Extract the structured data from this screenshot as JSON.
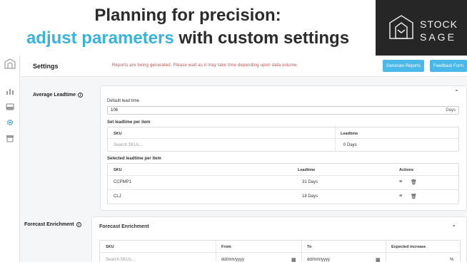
{
  "banner": {
    "headline_line1": "Planning for precision:",
    "headline_accent": "adjust parameters",
    "headline_rest": " with custom settings",
    "logo_word1": "STOCK",
    "logo_word2": "SAGE",
    "accent_color": "#3ab3dc"
  },
  "sidebar": {
    "items": [
      {
        "icon": "logo-icon"
      },
      {
        "icon": "bar-chart-icon"
      },
      {
        "icon": "inbox-icon"
      },
      {
        "icon": "gear-icon",
        "active": true
      },
      {
        "icon": "archive-icon"
      }
    ]
  },
  "header": {
    "title": "Settings",
    "status_message": "Reports are being generated. Please wait as it may take time depending upon data volume.",
    "generate_label": "Generate Reports",
    "feedback_label": "Feedback Form"
  },
  "leadtime": {
    "section_label": "Average Leadtime",
    "default_label": "Default lead time",
    "default_value": "106",
    "default_unit": "Days",
    "set_label": "Set leadtime per item",
    "set_table": {
      "col_sku": "SKU",
      "col_leadtime": "Leadtime",
      "sku_placeholder": "Search SKUs...",
      "leadtime_placeholder": "0 Days"
    },
    "selected_label": "Selected leadtime per item",
    "selected_table": {
      "col_sku": "SKU",
      "col_leadtime": "Leadtime",
      "col_actions": "Actions",
      "rows": [
        {
          "sku": "CCPMP1",
          "leadtime": "31 Days"
        },
        {
          "sku": "CLJ",
          "leadtime": "18 Days"
        }
      ]
    }
  },
  "forecast": {
    "section_label": "Forecast Enrichment",
    "card_title": "Forecast Enrichment",
    "col_sku": "SKU",
    "col_from": "From",
    "col_to": "To",
    "col_increase": "Expected increase",
    "sku_placeholder": "Search SKUs...",
    "from_placeholder": "dd/mm/yyyy",
    "to_placeholder": "dd/mm/yyyy",
    "increase_unit": "%"
  }
}
